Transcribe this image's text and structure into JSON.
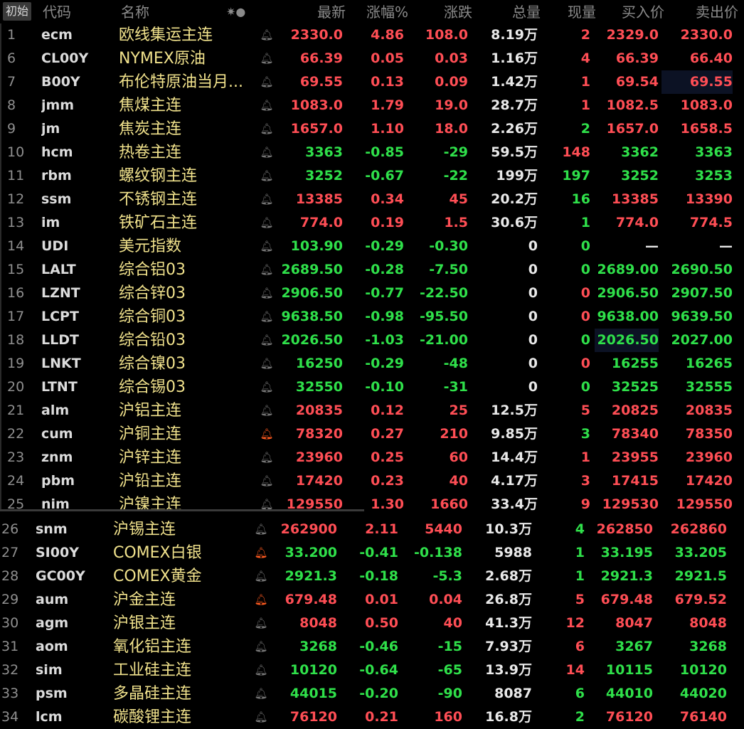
{
  "header": {
    "init_label": "初始",
    "code": "代码",
    "name": "名称",
    "star": "✷●",
    "last": "最新",
    "pct": "涨幅%",
    "chg": "涨跌",
    "vol": "总量",
    "cur": "现量",
    "bid": "买入价",
    "ask": "卖出价"
  },
  "rows": [
    {
      "idx": "1",
      "code": "ecm",
      "name": "欧线集运主连",
      "bell": "off",
      "last": "2330.0",
      "pct": "4.86",
      "chg": "108.0",
      "vol": "8.19万",
      "cur": "2",
      "bid": "2329.0",
      "ask": "2330.0",
      "dir": "up",
      "cur_dir": "up",
      "bid_dir": "up",
      "ask_dir": "up"
    },
    {
      "idx": "6",
      "code": "CL00Y",
      "name": "NYMEX原油",
      "bell": "off",
      "last": "66.39",
      "pct": "0.05",
      "chg": "0.03",
      "vol": "1.16万",
      "cur": "4",
      "bid": "66.39",
      "ask": "66.40",
      "dir": "up",
      "cur_dir": "up",
      "bid_dir": "up",
      "ask_dir": "up"
    },
    {
      "idx": "7",
      "code": "B00Y",
      "name": "布伦特原油当月...",
      "bell": "off",
      "last": "69.55",
      "pct": "0.13",
      "chg": "0.09",
      "vol": "1.42万",
      "cur": "1",
      "bid": "69.54",
      "ask": "69.55",
      "dir": "up",
      "cur_dir": "up",
      "bid_dir": "up",
      "ask_dir": "up",
      "ask_hl": true
    },
    {
      "idx": "8",
      "code": "jmm",
      "name": "焦煤主连",
      "bell": "off",
      "last": "1083.0",
      "pct": "1.79",
      "chg": "19.0",
      "vol": "28.7万",
      "cur": "1",
      "bid": "1082.5",
      "ask": "1083.0",
      "dir": "up",
      "cur_dir": "up",
      "bid_dir": "up",
      "ask_dir": "up"
    },
    {
      "idx": "9",
      "code": "jm",
      "name": "焦炭主连",
      "bell": "off",
      "last": "1657.0",
      "pct": "1.10",
      "chg": "18.0",
      "vol": "2.26万",
      "cur": "2",
      "bid": "1657.0",
      "ask": "1658.5",
      "dir": "up",
      "cur_dir": "dn",
      "bid_dir": "up",
      "ask_dir": "up"
    },
    {
      "idx": "10",
      "code": "hcm",
      "name": "热卷主连",
      "bell": "off",
      "last": "3363",
      "pct": "-0.85",
      "chg": "-29",
      "vol": "59.5万",
      "cur": "148",
      "bid": "3362",
      "ask": "3363",
      "dir": "dn",
      "cur_dir": "up",
      "bid_dir": "dn",
      "ask_dir": "dn"
    },
    {
      "idx": "11",
      "code": "rbm",
      "name": "螺纹钢主连",
      "bell": "off",
      "last": "3252",
      "pct": "-0.67",
      "chg": "-22",
      "vol": "199万",
      "cur": "197",
      "bid": "3252",
      "ask": "3253",
      "dir": "dn",
      "cur_dir": "dn",
      "bid_dir": "dn",
      "ask_dir": "dn"
    },
    {
      "idx": "12",
      "code": "ssm",
      "name": "不锈钢主连",
      "bell": "off",
      "last": "13385",
      "pct": "0.34",
      "chg": "45",
      "vol": "20.2万",
      "cur": "16",
      "bid": "13385",
      "ask": "13390",
      "dir": "up",
      "cur_dir": "dn",
      "bid_dir": "up",
      "ask_dir": "up"
    },
    {
      "idx": "13",
      "code": "im",
      "name": "铁矿石主连",
      "bell": "off",
      "last": "774.0",
      "pct": "0.19",
      "chg": "1.5",
      "vol": "30.6万",
      "cur": "1",
      "bid": "774.0",
      "ask": "774.5",
      "dir": "up",
      "cur_dir": "dn",
      "bid_dir": "up",
      "ask_dir": "up"
    },
    {
      "idx": "14",
      "code": "UDI",
      "name": "美元指数",
      "bell": "off",
      "last": "103.90",
      "pct": "-0.29",
      "chg": "-0.30",
      "vol": "0",
      "cur": "0",
      "bid": "—",
      "ask": "—",
      "dir": "dn",
      "cur_dir": "dn",
      "bid_dir": "ne",
      "ask_dir": "ne"
    },
    {
      "idx": "15",
      "code": "LALT",
      "name": "综合铝03",
      "bell": "off",
      "last": "2689.50",
      "pct": "-0.28",
      "chg": "-7.50",
      "vol": "0",
      "cur": "0",
      "bid": "2689.00",
      "ask": "2690.50",
      "dir": "dn",
      "cur_dir": "dn",
      "bid_dir": "dn",
      "ask_dir": "dn"
    },
    {
      "idx": "16",
      "code": "LZNT",
      "name": "综合锌03",
      "bell": "off",
      "last": "2906.50",
      "pct": "-0.77",
      "chg": "-22.50",
      "vol": "0",
      "cur": "0",
      "bid": "2906.50",
      "ask": "2907.50",
      "dir": "dn",
      "cur_dir": "up",
      "bid_dir": "dn",
      "ask_dir": "dn"
    },
    {
      "idx": "17",
      "code": "LCPT",
      "name": "综合铜03",
      "bell": "off",
      "last": "9638.50",
      "pct": "-0.98",
      "chg": "-95.50",
      "vol": "0",
      "cur": "0",
      "bid": "9638.00",
      "ask": "9639.50",
      "dir": "dn",
      "cur_dir": "up",
      "bid_dir": "dn",
      "ask_dir": "dn"
    },
    {
      "idx": "18",
      "code": "LLDT",
      "name": "综合铅03",
      "bell": "off",
      "last": "2026.50",
      "pct": "-1.03",
      "chg": "-21.00",
      "vol": "0",
      "cur": "0",
      "bid": "2026.50",
      "ask": "2027.00",
      "dir": "dn",
      "cur_dir": "dn",
      "bid_dir": "dn",
      "ask_dir": "dn",
      "bid_hl": true
    },
    {
      "idx": "19",
      "code": "LNKT",
      "name": "综合镍03",
      "bell": "off",
      "last": "16250",
      "pct": "-0.29",
      "chg": "-48",
      "vol": "0",
      "cur": "0",
      "bid": "16255",
      "ask": "16265",
      "dir": "dn",
      "cur_dir": "up",
      "bid_dir": "dn",
      "ask_dir": "dn"
    },
    {
      "idx": "20",
      "code": "LTNT",
      "name": "综合锡03",
      "bell": "off",
      "last": "32550",
      "pct": "-0.10",
      "chg": "-31",
      "vol": "0",
      "cur": "0",
      "bid": "32525",
      "ask": "32555",
      "dir": "dn",
      "cur_dir": "dn",
      "bid_dir": "dn",
      "ask_dir": "dn"
    },
    {
      "idx": "21",
      "code": "alm",
      "name": "沪铝主连",
      "bell": "off",
      "last": "20835",
      "pct": "0.12",
      "chg": "25",
      "vol": "12.5万",
      "cur": "5",
      "bid": "20825",
      "ask": "20835",
      "dir": "up",
      "cur_dir": "up",
      "bid_dir": "up",
      "ask_dir": "up"
    },
    {
      "idx": "22",
      "code": "cum",
      "name": "沪铜主连",
      "bell": "on",
      "last": "78320",
      "pct": "0.27",
      "chg": "210",
      "vol": "9.85万",
      "cur": "3",
      "bid": "78340",
      "ask": "78350",
      "dir": "up",
      "cur_dir": "dn",
      "bid_dir": "up",
      "ask_dir": "up"
    },
    {
      "idx": "23",
      "code": "znm",
      "name": "沪锌主连",
      "bell": "off",
      "last": "23960",
      "pct": "0.25",
      "chg": "60",
      "vol": "14.4万",
      "cur": "1",
      "bid": "23955",
      "ask": "23960",
      "dir": "up",
      "cur_dir": "up",
      "bid_dir": "up",
      "ask_dir": "up"
    },
    {
      "idx": "24",
      "code": "pbm",
      "name": "沪铅主连",
      "bell": "off",
      "last": "17420",
      "pct": "0.23",
      "chg": "40",
      "vol": "4.17万",
      "cur": "3",
      "bid": "17415",
      "ask": "17420",
      "dir": "up",
      "cur_dir": "up",
      "bid_dir": "up",
      "ask_dir": "up"
    },
    {
      "idx": "25",
      "code": "nim",
      "name": "沪镍主连",
      "bell": "off",
      "last": "129550",
      "pct": "1.30",
      "chg": "1660",
      "vol": "33.4万",
      "cur": "9",
      "bid": "129530",
      "ask": "129550",
      "dir": "up",
      "cur_dir": "up",
      "bid_dir": "up",
      "ask_dir": "up"
    },
    {
      "idx": "26",
      "code": "snm",
      "name": "沪锡主连",
      "bell": "off",
      "last": "262900",
      "pct": "2.11",
      "chg": "5440",
      "vol": "10.3万",
      "cur": "4",
      "bid": "262850",
      "ask": "262860",
      "dir": "up",
      "cur_dir": "dn",
      "bid_dir": "up",
      "ask_dir": "up"
    },
    {
      "idx": "27",
      "code": "SI00Y",
      "name": "COMEX白银",
      "bell": "on",
      "last": "33.200",
      "pct": "-0.41",
      "chg": "-0.138",
      "vol": "5988",
      "cur": "1",
      "bid": "33.195",
      "ask": "33.205",
      "dir": "dn",
      "cur_dir": "dn",
      "bid_dir": "dn",
      "ask_dir": "dn"
    },
    {
      "idx": "28",
      "code": "GC00Y",
      "name": "COMEX黄金",
      "bell": "off",
      "last": "2921.3",
      "pct": "-0.18",
      "chg": "-5.3",
      "vol": "2.68万",
      "cur": "1",
      "bid": "2921.3",
      "ask": "2921.5",
      "dir": "dn",
      "cur_dir": "dn",
      "bid_dir": "dn",
      "ask_dir": "dn"
    },
    {
      "idx": "29",
      "code": "aum",
      "name": "沪金主连",
      "bell": "on",
      "last": "679.48",
      "pct": "0.01",
      "chg": "0.04",
      "vol": "26.8万",
      "cur": "5",
      "bid": "679.48",
      "ask": "679.52",
      "dir": "up",
      "cur_dir": "up",
      "bid_dir": "up",
      "ask_dir": "up"
    },
    {
      "idx": "30",
      "code": "agm",
      "name": "沪银主连",
      "bell": "off",
      "last": "8048",
      "pct": "0.50",
      "chg": "40",
      "vol": "41.3万",
      "cur": "12",
      "bid": "8047",
      "ask": "8048",
      "dir": "up",
      "cur_dir": "up",
      "bid_dir": "up",
      "ask_dir": "up"
    },
    {
      "idx": "31",
      "code": "aom",
      "name": "氧化铝主连",
      "bell": "off",
      "last": "3268",
      "pct": "-0.46",
      "chg": "-15",
      "vol": "7.93万",
      "cur": "6",
      "bid": "3267",
      "ask": "3268",
      "dir": "dn",
      "cur_dir": "up",
      "bid_dir": "dn",
      "ask_dir": "dn"
    },
    {
      "idx": "32",
      "code": "sim",
      "name": "工业硅主连",
      "bell": "off",
      "last": "10120",
      "pct": "-0.64",
      "chg": "-65",
      "vol": "13.9万",
      "cur": "14",
      "bid": "10115",
      "ask": "10120",
      "dir": "dn",
      "cur_dir": "up",
      "bid_dir": "dn",
      "ask_dir": "dn"
    },
    {
      "idx": "33",
      "code": "psm",
      "name": "多晶硅主连",
      "bell": "off",
      "last": "44015",
      "pct": "-0.20",
      "chg": "-90",
      "vol": "8087",
      "cur": "6",
      "bid": "44010",
      "ask": "44020",
      "dir": "dn",
      "cur_dir": "dn",
      "bid_dir": "dn",
      "ask_dir": "dn"
    },
    {
      "idx": "34",
      "code": "lcm",
      "name": "碳酸锂主连",
      "bell": "off",
      "last": "76120",
      "pct": "0.21",
      "chg": "160",
      "vol": "16.8万",
      "cur": "2",
      "bid": "76120",
      "ask": "76140",
      "dir": "up",
      "cur_dir": "dn",
      "bid_dir": "up",
      "ask_dir": "up"
    }
  ],
  "colors": {
    "up": "#ff4e55",
    "down": "#2fe04a",
    "name": "#f1e28c",
    "bell_on": "#ff5a1f",
    "background": "#000000"
  },
  "icons": {
    "bell": "bell-icon"
  }
}
